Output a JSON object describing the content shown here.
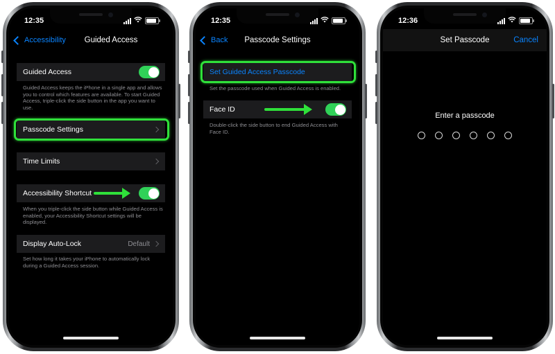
{
  "phone1": {
    "time": "12:35",
    "nav": {
      "back_label": "Accessibility",
      "title": "Guided Access"
    },
    "guided_access": {
      "label": "Guided Access",
      "on": true,
      "note": "Guided Access keeps the iPhone in a single app and allows you to control which features are available. To start Guided Access, triple-click the side button in the app you want to use."
    },
    "passcode_settings": {
      "label": "Passcode Settings"
    },
    "time_limits": {
      "label": "Time Limits"
    },
    "accessibility_shortcut": {
      "label": "Accessibility Shortcut",
      "on": true,
      "note": "When you triple-click the side button while Guided Access is enabled, your Accessibility Shortcut settings will be displayed."
    },
    "display_auto_lock": {
      "label": "Display Auto-Lock",
      "value": "Default",
      "note": "Set how long it takes your iPhone to automatically lock during a Guided Access session."
    }
  },
  "phone2": {
    "time": "12:35",
    "nav": {
      "back_label": "Back",
      "title": "Passcode Settings"
    },
    "set_passcode": {
      "label": "Set Guided Access Passcode",
      "note": "Set the passcode used when Guided Access is enabled."
    },
    "face_id": {
      "label": "Face ID",
      "on": true,
      "note": "Double-click the side button to end Guided Access with Face ID."
    }
  },
  "phone3": {
    "time": "12:36",
    "nav": {
      "title": "Set Passcode",
      "cancel_label": "Cancel"
    },
    "prompt": "Enter a passcode",
    "digits": 6
  },
  "colors": {
    "accent": "#0a84ff",
    "toggle_on": "#30d158",
    "highlight": "#2fe03a",
    "cell_bg": "#1c1c1e",
    "note_text": "#8e8e93"
  }
}
